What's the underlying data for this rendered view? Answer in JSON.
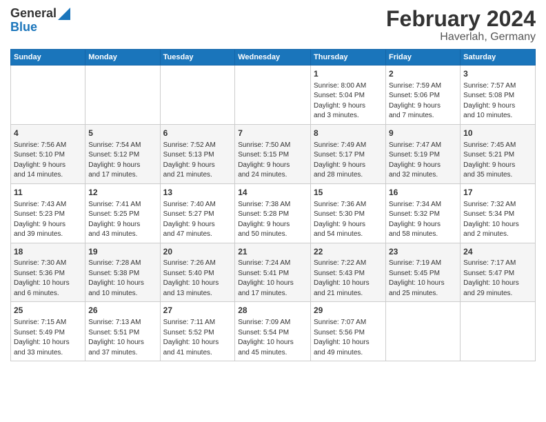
{
  "logo": {
    "line1": "General",
    "line2": "Blue"
  },
  "title": "February 2024",
  "subtitle": "Haverlah, Germany",
  "days_of_week": [
    "Sunday",
    "Monday",
    "Tuesday",
    "Wednesday",
    "Thursday",
    "Friday",
    "Saturday"
  ],
  "weeks": [
    [
      {
        "day": "",
        "info": ""
      },
      {
        "day": "",
        "info": ""
      },
      {
        "day": "",
        "info": ""
      },
      {
        "day": "",
        "info": ""
      },
      {
        "day": "1",
        "info": "Sunrise: 8:00 AM\nSunset: 5:04 PM\nDaylight: 9 hours\nand 3 minutes."
      },
      {
        "day": "2",
        "info": "Sunrise: 7:59 AM\nSunset: 5:06 PM\nDaylight: 9 hours\nand 7 minutes."
      },
      {
        "day": "3",
        "info": "Sunrise: 7:57 AM\nSunset: 5:08 PM\nDaylight: 9 hours\nand 10 minutes."
      }
    ],
    [
      {
        "day": "4",
        "info": "Sunrise: 7:56 AM\nSunset: 5:10 PM\nDaylight: 9 hours\nand 14 minutes."
      },
      {
        "day": "5",
        "info": "Sunrise: 7:54 AM\nSunset: 5:12 PM\nDaylight: 9 hours\nand 17 minutes."
      },
      {
        "day": "6",
        "info": "Sunrise: 7:52 AM\nSunset: 5:13 PM\nDaylight: 9 hours\nand 21 minutes."
      },
      {
        "day": "7",
        "info": "Sunrise: 7:50 AM\nSunset: 5:15 PM\nDaylight: 9 hours\nand 24 minutes."
      },
      {
        "day": "8",
        "info": "Sunrise: 7:49 AM\nSunset: 5:17 PM\nDaylight: 9 hours\nand 28 minutes."
      },
      {
        "day": "9",
        "info": "Sunrise: 7:47 AM\nSunset: 5:19 PM\nDaylight: 9 hours\nand 32 minutes."
      },
      {
        "day": "10",
        "info": "Sunrise: 7:45 AM\nSunset: 5:21 PM\nDaylight: 9 hours\nand 35 minutes."
      }
    ],
    [
      {
        "day": "11",
        "info": "Sunrise: 7:43 AM\nSunset: 5:23 PM\nDaylight: 9 hours\nand 39 minutes."
      },
      {
        "day": "12",
        "info": "Sunrise: 7:41 AM\nSunset: 5:25 PM\nDaylight: 9 hours\nand 43 minutes."
      },
      {
        "day": "13",
        "info": "Sunrise: 7:40 AM\nSunset: 5:27 PM\nDaylight: 9 hours\nand 47 minutes."
      },
      {
        "day": "14",
        "info": "Sunrise: 7:38 AM\nSunset: 5:28 PM\nDaylight: 9 hours\nand 50 minutes."
      },
      {
        "day": "15",
        "info": "Sunrise: 7:36 AM\nSunset: 5:30 PM\nDaylight: 9 hours\nand 54 minutes."
      },
      {
        "day": "16",
        "info": "Sunrise: 7:34 AM\nSunset: 5:32 PM\nDaylight: 9 hours\nand 58 minutes."
      },
      {
        "day": "17",
        "info": "Sunrise: 7:32 AM\nSunset: 5:34 PM\nDaylight: 10 hours\nand 2 minutes."
      }
    ],
    [
      {
        "day": "18",
        "info": "Sunrise: 7:30 AM\nSunset: 5:36 PM\nDaylight: 10 hours\nand 6 minutes."
      },
      {
        "day": "19",
        "info": "Sunrise: 7:28 AM\nSunset: 5:38 PM\nDaylight: 10 hours\nand 10 minutes."
      },
      {
        "day": "20",
        "info": "Sunrise: 7:26 AM\nSunset: 5:40 PM\nDaylight: 10 hours\nand 13 minutes."
      },
      {
        "day": "21",
        "info": "Sunrise: 7:24 AM\nSunset: 5:41 PM\nDaylight: 10 hours\nand 17 minutes."
      },
      {
        "day": "22",
        "info": "Sunrise: 7:22 AM\nSunset: 5:43 PM\nDaylight: 10 hours\nand 21 minutes."
      },
      {
        "day": "23",
        "info": "Sunrise: 7:19 AM\nSunset: 5:45 PM\nDaylight: 10 hours\nand 25 minutes."
      },
      {
        "day": "24",
        "info": "Sunrise: 7:17 AM\nSunset: 5:47 PM\nDaylight: 10 hours\nand 29 minutes."
      }
    ],
    [
      {
        "day": "25",
        "info": "Sunrise: 7:15 AM\nSunset: 5:49 PM\nDaylight: 10 hours\nand 33 minutes."
      },
      {
        "day": "26",
        "info": "Sunrise: 7:13 AM\nSunset: 5:51 PM\nDaylight: 10 hours\nand 37 minutes."
      },
      {
        "day": "27",
        "info": "Sunrise: 7:11 AM\nSunset: 5:52 PM\nDaylight: 10 hours\nand 41 minutes."
      },
      {
        "day": "28",
        "info": "Sunrise: 7:09 AM\nSunset: 5:54 PM\nDaylight: 10 hours\nand 45 minutes."
      },
      {
        "day": "29",
        "info": "Sunrise: 7:07 AM\nSunset: 5:56 PM\nDaylight: 10 hours\nand 49 minutes."
      },
      {
        "day": "",
        "info": ""
      },
      {
        "day": "",
        "info": ""
      }
    ]
  ]
}
